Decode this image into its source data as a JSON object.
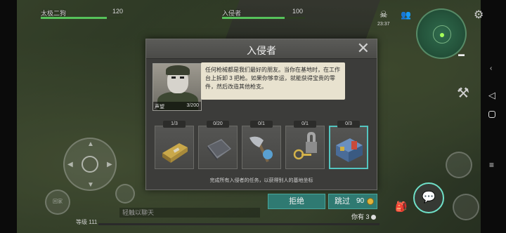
{
  "hud": {
    "player_name": "太极二狗",
    "player_hp": "120",
    "player_hp_fraction": 0.8,
    "enemy_name": "入侵者",
    "enemy_hp": "100",
    "enemy_hp_fraction": 0.75,
    "time": "23:37",
    "level_label": "等级 111",
    "chat_placeholder": "轻触以聊天",
    "you_have_label": "你有 3",
    "left_btn_label": "回家",
    "xp_fraction": 0.0
  },
  "dialog": {
    "title": "入侵者",
    "close_symbol": "✕",
    "speech": "任何枪械都是我们最好的朋友。当你在基地时，在工作台上拆卸 3 把枪。如果你够幸运，就能获得宝贵的零件，然后改造其他枪支。",
    "reputation_label": "声望",
    "reputation_value": "3/200",
    "items": [
      {
        "count": "1/3",
        "icon": "ammo-box-icon"
      },
      {
        "count": "0/20",
        "icon": "metal-plate-icon"
      },
      {
        "count": "0/1",
        "icon": "axe-icon"
      },
      {
        "count": "0/1",
        "icon": "padlock-key-icon"
      },
      {
        "count": "0/3",
        "icon": "toolbox-icon",
        "active": true
      }
    ],
    "footer": "完成所有入侵者的任务，以获得别人的基地坐标"
  },
  "buttons": {
    "refuse": "拒绝",
    "skip": "跳过",
    "skip_cost": "90"
  },
  "colors": {
    "accent": "#2f7a72",
    "active_border": "#54c5c0",
    "hp_green": "#56c25a",
    "gold": "#e0b33b"
  }
}
